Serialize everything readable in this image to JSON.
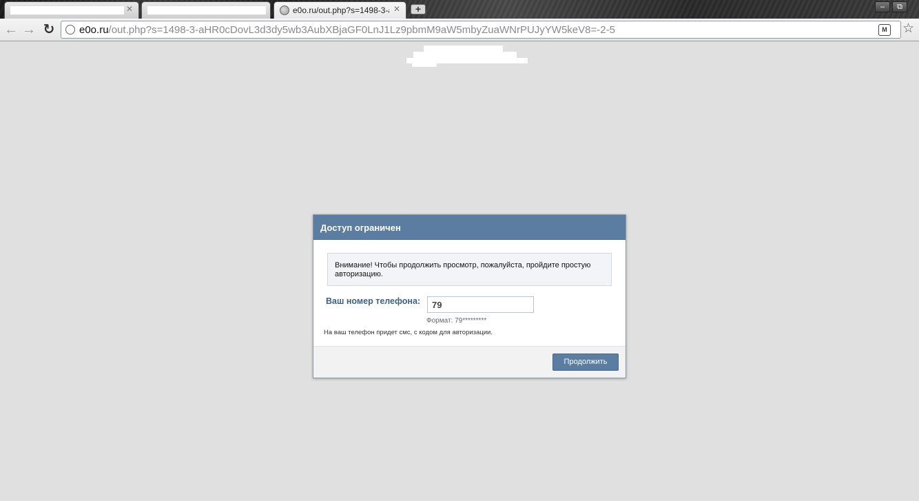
{
  "browser": {
    "tabs": [
      {
        "title": "",
        "active": false
      },
      {
        "title": "",
        "active": false
      },
      {
        "title": "e0o.ru/out.php?s=1498-3-a",
        "active": true
      }
    ],
    "new_tab_label": "+",
    "window_controls": {
      "minimize": "‒",
      "restore": "⧉"
    },
    "url_host": "e0o.ru",
    "url_path": "/out.php?s=1498-3-aHR0cDovL3d3dy5wb3AubXBjaGF0LnJ1Lz9pbmM9aW5mbyZuaWNrPUJyYW5keV8=-2-5",
    "extension_label": "M"
  },
  "dialog": {
    "title": "Доступ ограничен",
    "notice": "Внимание! Чтобы продолжить просмотр, пожалуйста, пройдите простую авторизацию.",
    "phone_label": "Ваш номер телефона:",
    "phone_value": "79",
    "format_hint": "Формат: 79*********",
    "sms_note": "На ваш телефон придет смс, с кодом для авторизации.",
    "continue_label": "Продолжить"
  }
}
